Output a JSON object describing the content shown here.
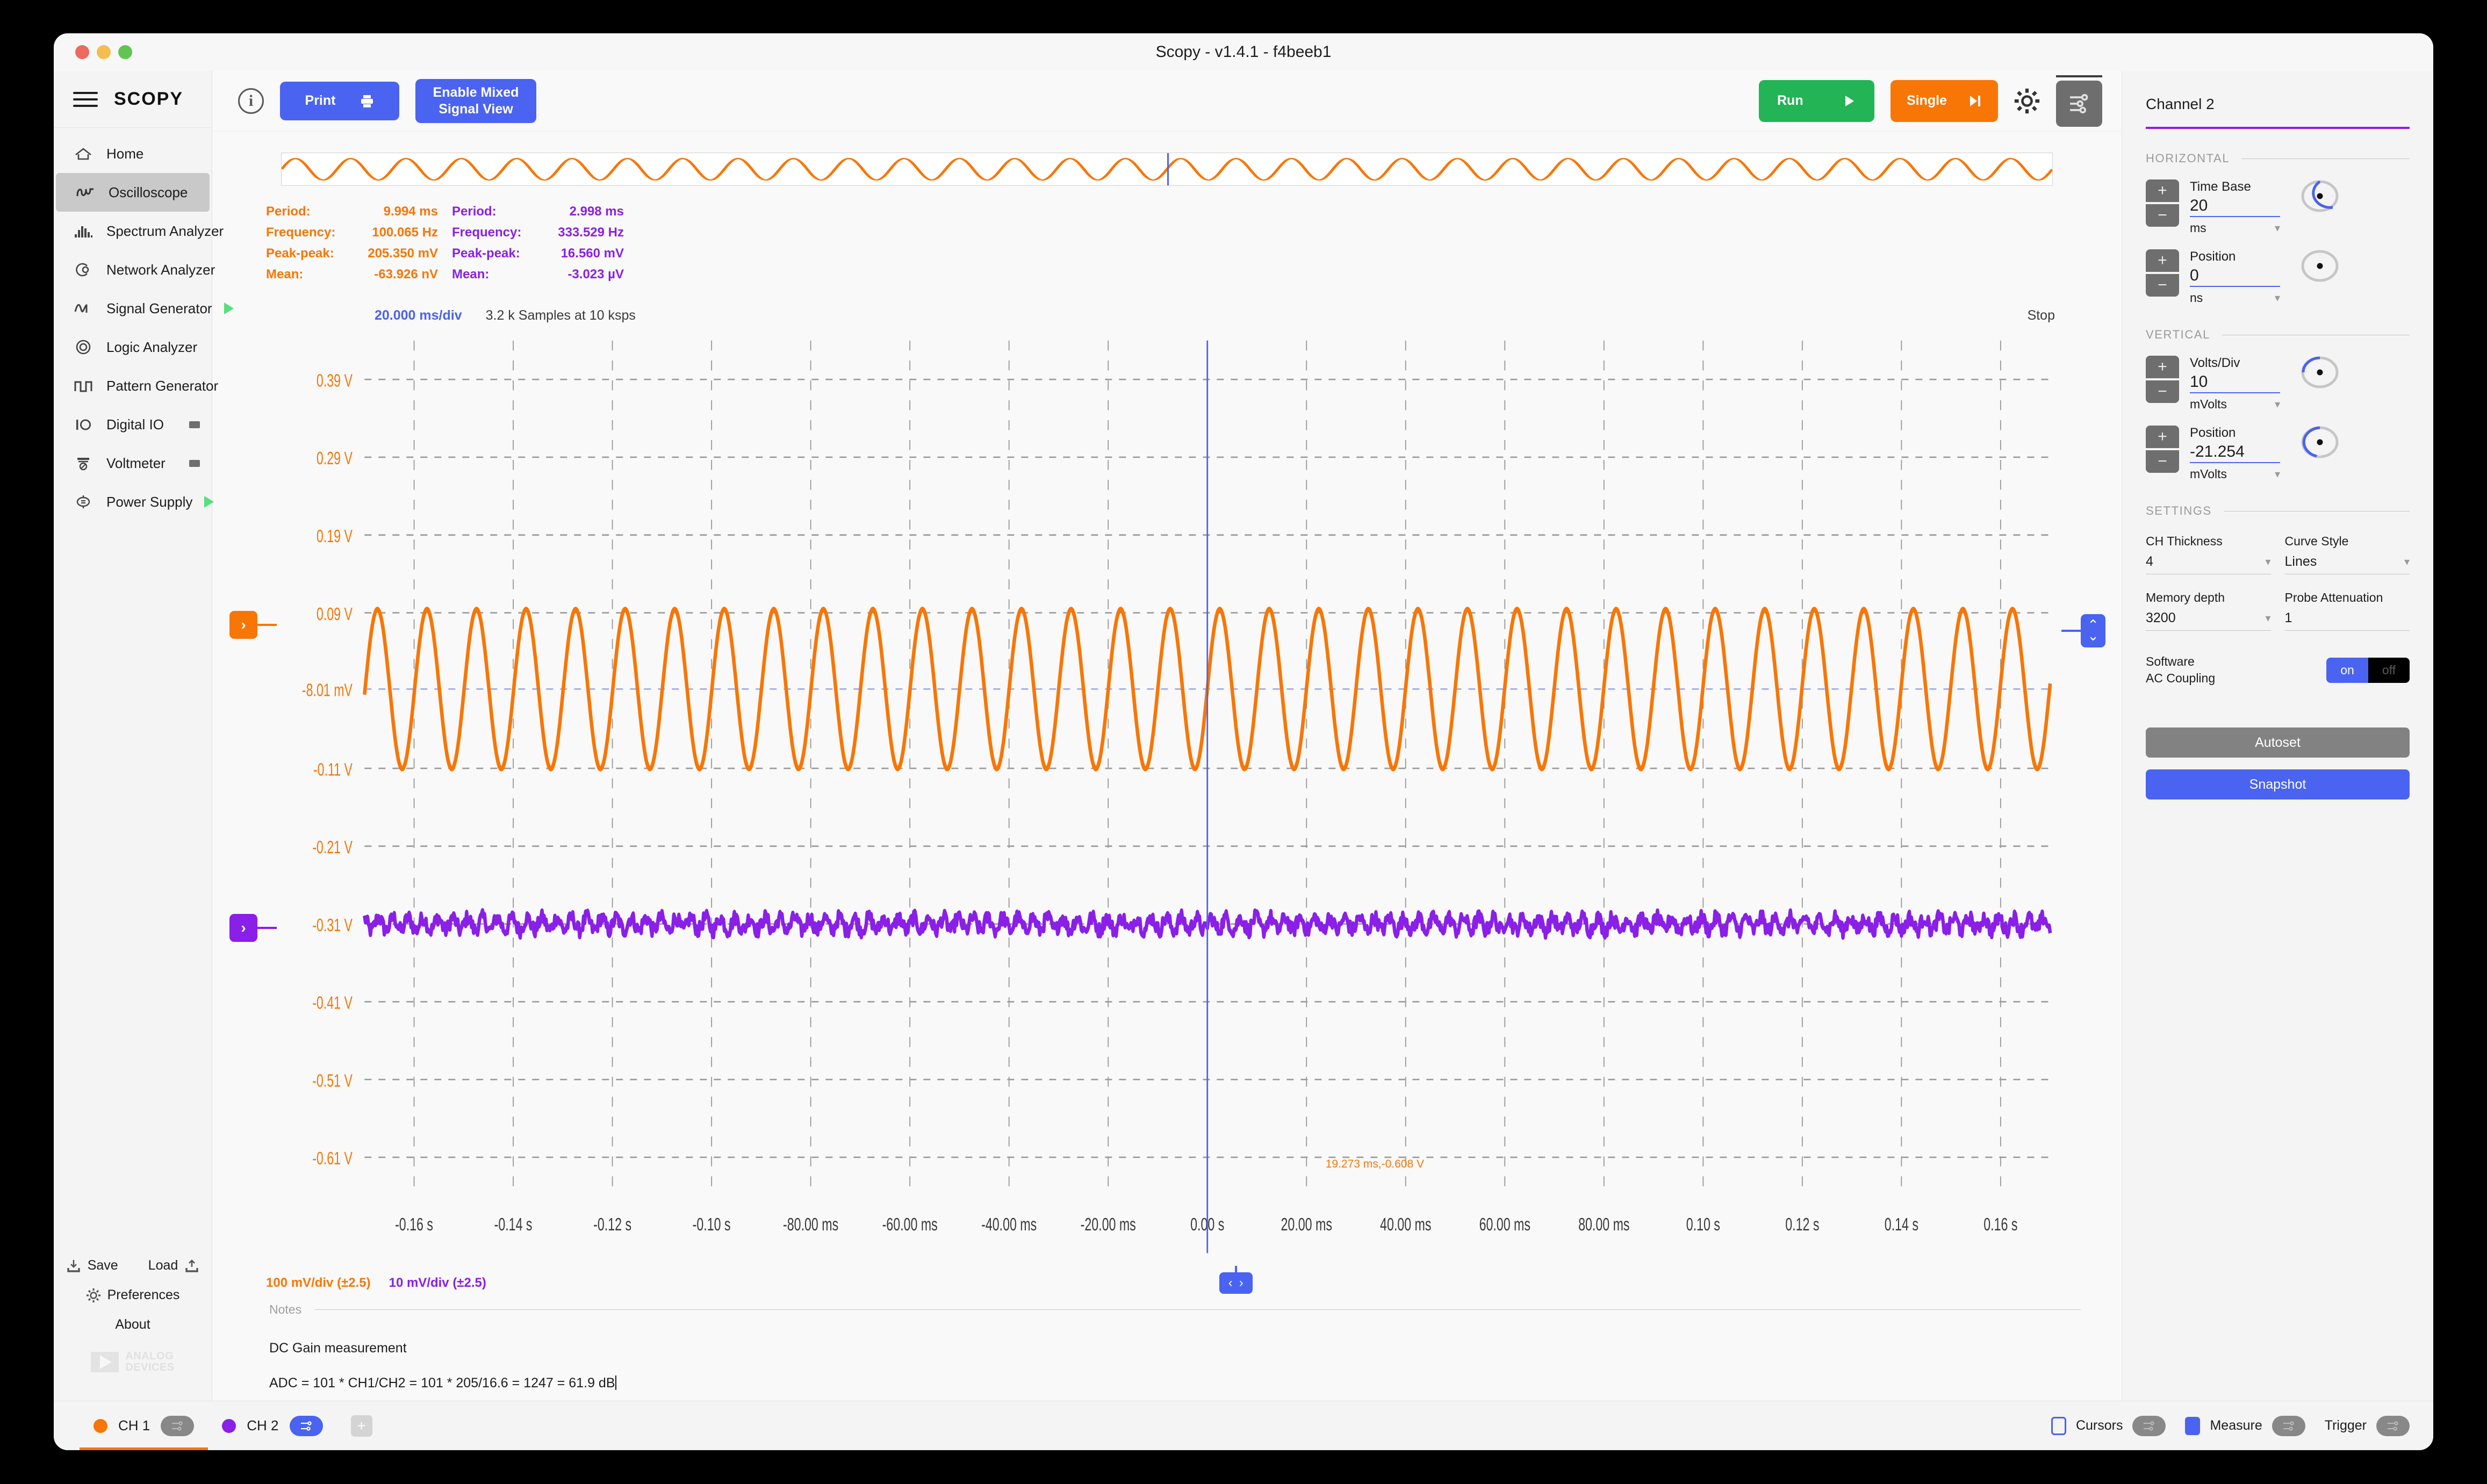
{
  "window": {
    "title": "Scopy - v1.4.1 - f4beeb1"
  },
  "sidebar": {
    "logo": "SCOPY",
    "items": [
      {
        "label": "Home",
        "icon": "home-icon",
        "status": "none"
      },
      {
        "label": "Oscilloscope",
        "icon": "oscilloscope-icon",
        "status": "square"
      },
      {
        "label": "Spectrum Analyzer",
        "icon": "spectrum-icon",
        "status": "square"
      },
      {
        "label": "Network Analyzer",
        "icon": "network-icon",
        "status": "square"
      },
      {
        "label": "Signal Generator",
        "icon": "signal-generator-icon",
        "status": "play"
      },
      {
        "label": "Logic Analyzer",
        "icon": "logic-analyzer-icon",
        "status": "square"
      },
      {
        "label": "Pattern Generator",
        "icon": "pattern-generator-icon",
        "status": "square"
      },
      {
        "label": "Digital IO",
        "icon": "digital-io-icon",
        "status": "square"
      },
      {
        "label": "Voltmeter",
        "icon": "voltmeter-icon",
        "status": "square"
      },
      {
        "label": "Power Supply",
        "icon": "power-supply-icon",
        "status": "play"
      }
    ],
    "footer": {
      "save": "Save",
      "load": "Load",
      "preferences": "Preferences",
      "about": "About",
      "brand_line1": "ANALOG",
      "brand_line2": "DEVICES"
    }
  },
  "toolbar": {
    "info_glyph": "i",
    "print_label": "Print",
    "mixed_line1": "Enable Mixed",
    "mixed_line2": "Signal View",
    "run_label": "Run",
    "single_label": "Single"
  },
  "plot": {
    "timebase_label": "20.000 ms/div",
    "samples_label": "3.2 k Samples at 10 ksps",
    "status": "Stop",
    "cursor_readout": "19.273 ms,-0.608 V",
    "div_ch1": "100 mV/div (±2.5)",
    "div_ch2": "10 mV/div (±2.5)"
  },
  "measurements": {
    "ch1": [
      {
        "label": "Period:",
        "value": "9.994 ms"
      },
      {
        "label": "Frequency:",
        "value": "100.065 Hz"
      },
      {
        "label": "Peak-peak:",
        "value": "205.350 mV"
      },
      {
        "label": "Mean:",
        "value": "-63.926 nV"
      }
    ],
    "ch2": [
      {
        "label": "Period:",
        "value": "2.998 ms"
      },
      {
        "label": "Frequency:",
        "value": "333.529 Hz"
      },
      {
        "label": "Peak-peak:",
        "value": "16.560 mV"
      },
      {
        "label": "Mean:",
        "value": "-3.023 µV"
      }
    ]
  },
  "notes": {
    "label": "Notes",
    "line1": "DC Gain measurement",
    "line2": "ADC = 101 * CH1/CH2 = 101 * 205/16.6 = 1247 = 61.9 dB"
  },
  "channel_panel": {
    "title": "Channel 2",
    "accent": "#8a1fe8",
    "horizontal_label": "HORIZONTAL",
    "vertical_label": "VERTICAL",
    "settings_label": "SETTINGS",
    "time_base": {
      "label": "Time Base",
      "value": "20",
      "unit": "ms"
    },
    "h_position": {
      "label": "Position",
      "value": "0",
      "unit": "ns"
    },
    "volts_div": {
      "label": "Volts/Div",
      "value": "10",
      "unit": "mVolts"
    },
    "v_position": {
      "label": "Position",
      "value": "-21.254",
      "unit": "mVolts"
    },
    "ch_thickness": {
      "label": "CH Thickness",
      "value": "4"
    },
    "curve_style": {
      "label": "Curve Style",
      "value": "Lines"
    },
    "memory_depth": {
      "label": "Memory depth",
      "value": "3200"
    },
    "probe_attenuation": {
      "label": "Probe Attenuation",
      "value": "1"
    },
    "ac_coupling": {
      "label_line1": "Software",
      "label_line2": "AC Coupling",
      "on": "on",
      "off": "off",
      "state": "on"
    },
    "autoset": "Autoset",
    "snapshot": "Snapshot"
  },
  "statusbar": {
    "ch1": "CH 1",
    "ch2": "CH 2",
    "ch1_color": "#f87606",
    "ch2_color": "#8a1fe8",
    "add": "+",
    "cursors": "Cursors",
    "measure": "Measure",
    "trigger": "Trigger"
  },
  "chart_data": {
    "type": "line",
    "title": "Oscilloscope time-domain capture",
    "xlabel": "",
    "ylabel": "",
    "xlim": [
      -0.17,
      0.17
    ],
    "ylim": [
      -0.66,
      0.44
    ],
    "grid": true,
    "legend": "none",
    "x_ticks": [
      "-0.16 s",
      "-0.14 s",
      "-0.12 s",
      "-0.10 s",
      "-80.00 ms",
      "-60.00 ms",
      "-40.00 ms",
      "-20.00 ms",
      "0.00 s",
      "20.00 ms",
      "40.00 ms",
      "60.00 ms",
      "80.00 ms",
      "0.10 s",
      "0.12 s",
      "0.14 s",
      "0.16 s"
    ],
    "y_ticks": [
      "0.39 V",
      "0.29 V",
      "0.19 V",
      "0.09 V",
      "-8.01 mV",
      "-0.11 V",
      "-0.21 V",
      "-0.31 V",
      "-0.41 V",
      "-0.51 V",
      "-0.61 V"
    ],
    "y_tick_values": [
      0.39,
      0.29,
      0.19,
      0.09,
      -0.00801,
      -0.11,
      -0.21,
      -0.31,
      -0.41,
      -0.51,
      -0.61
    ],
    "series": [
      {
        "name": "CH 1",
        "color": "#f87606",
        "waveform": "sine",
        "frequency_hz": 100.065,
        "amplitude_v": 0.1027,
        "offset_v": -0.00801,
        "peak_to_peak_mv": 205.35,
        "mean_nv": -63.926,
        "period_ms": 9.994
      },
      {
        "name": "CH 2",
        "color": "#8a1fe8",
        "waveform": "noisy-sine",
        "frequency_hz": 333.529,
        "amplitude_v": 0.00828,
        "offset_v": -0.31,
        "noise_v": 0.018,
        "peak_to_peak_mv": 16.56,
        "mean_uv": -3.023,
        "period_ms": 2.998
      }
    ],
    "trigger_line_x": 0.0,
    "cursor_point": {
      "x_ms": 19.273,
      "y_v": -0.608
    }
  }
}
